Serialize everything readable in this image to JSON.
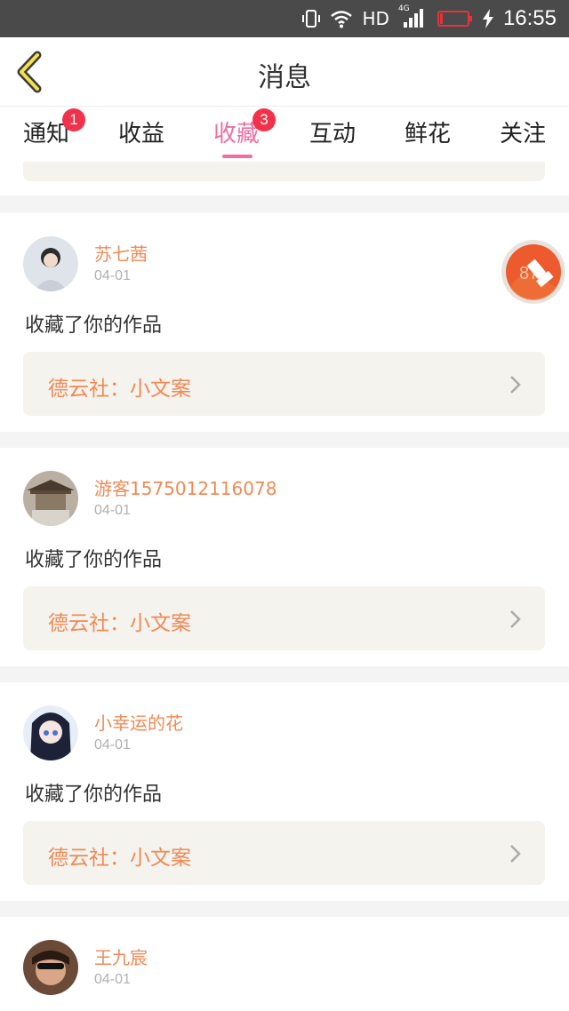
{
  "status_bar": {
    "network": "HD",
    "signal_sub": "4G",
    "time": "16:55"
  },
  "header": {
    "title": "消息"
  },
  "tabs": [
    {
      "label": "通知",
      "badge": "1"
    },
    {
      "label": "收益",
      "badge": ""
    },
    {
      "label": "收藏",
      "badge": "3",
      "active": true
    },
    {
      "label": "互动",
      "badge": ""
    },
    {
      "label": "鲜花",
      "badge": ""
    },
    {
      "label": "关注",
      "badge": ""
    }
  ],
  "feed": [
    {
      "user": "苏七茜",
      "date": "04-01",
      "action": "收藏了你的作品",
      "work": "德云社：小文案"
    },
    {
      "user": "游客1575012116078",
      "date": "04-01",
      "action": "收藏了你的作品",
      "work": "德云社：小文案"
    },
    {
      "user": "小幸运的花",
      "date": "04-01",
      "action": "收藏了你的作品",
      "work": "德云社：小文案"
    },
    {
      "user": "王九宸",
      "date": "04-01",
      "action": "",
      "work": ""
    }
  ],
  "floating_button": {
    "label": "87"
  },
  "colors": {
    "accent_pink": "#ee6fa3",
    "orange_text": "#f08a56",
    "badge_red": "#f2324b"
  }
}
